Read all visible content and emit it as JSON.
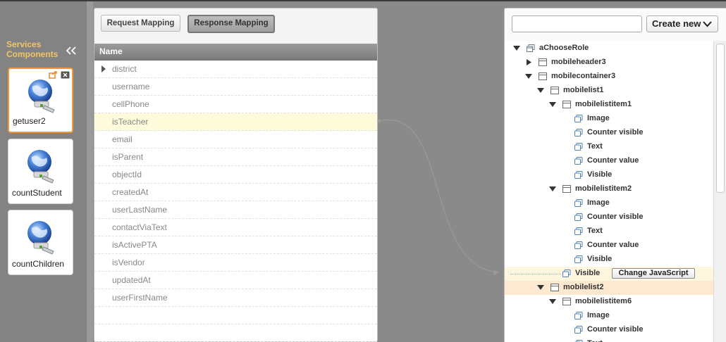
{
  "sidebar": {
    "title_line1": "Services",
    "title_line2": "Components",
    "services": [
      {
        "name": "getuser2",
        "selected": true
      },
      {
        "name": "countStudent",
        "selected": false
      },
      {
        "name": "countChildren",
        "selected": false
      }
    ]
  },
  "mapping": {
    "request_tab": "Request Mapping",
    "response_tab": "Response Mapping",
    "active_tab": "Response Mapping",
    "column_header": "Name",
    "fields": [
      "district",
      "username",
      "cellPhone",
      "isTeacher",
      "email",
      "isParent",
      "objectId",
      "createdAt",
      "userLastName",
      "contactViaText",
      "isActivePTA",
      "isVendor",
      "updatedAt",
      "userFirstName",
      "",
      ""
    ],
    "highlighted_field": "isTeacher"
  },
  "tree": {
    "search_placeholder": "",
    "create_new_label": "Create new",
    "change_js_label": "Change JavaScript",
    "nodes": [
      {
        "label": "aChooseRole",
        "level": 0,
        "toggle": "open",
        "icon": "page-icon"
      },
      {
        "label": "mobileheader3",
        "level": 1,
        "toggle": "closed",
        "icon": "container-icon"
      },
      {
        "label": "mobilecontainer3",
        "level": 1,
        "toggle": "open",
        "icon": "container-icon"
      },
      {
        "label": "mobilelist1",
        "level": 2,
        "toggle": "open",
        "icon": "container-icon"
      },
      {
        "label": "mobilelistitem1",
        "level": 3,
        "toggle": "open",
        "icon": "container-icon"
      },
      {
        "label": "Image",
        "level": 4,
        "toggle": "none",
        "icon": "property-icon"
      },
      {
        "label": "Counter visible",
        "level": 4,
        "toggle": "none",
        "icon": "property-icon"
      },
      {
        "label": "Text",
        "level": 4,
        "toggle": "none",
        "icon": "property-icon"
      },
      {
        "label": "Counter value",
        "level": 4,
        "toggle": "none",
        "icon": "property-icon"
      },
      {
        "label": "Visible",
        "level": 4,
        "toggle": "none",
        "icon": "property-icon"
      },
      {
        "label": "mobilelistitem2",
        "level": 3,
        "toggle": "open",
        "icon": "container-icon"
      },
      {
        "label": "Image",
        "level": 4,
        "toggle": "none",
        "icon": "property-icon"
      },
      {
        "label": "Counter visible",
        "level": 4,
        "toggle": "none",
        "icon": "property-icon"
      },
      {
        "label": "Text",
        "level": 4,
        "toggle": "none",
        "icon": "property-icon"
      },
      {
        "label": "Counter value",
        "level": 4,
        "toggle": "none",
        "icon": "property-icon"
      },
      {
        "label": "Visible",
        "level": 4,
        "toggle": "none",
        "icon": "property-icon"
      },
      {
        "label": "Visible",
        "level": 3,
        "toggle": "none",
        "icon": "property-icon",
        "mapped": true
      },
      {
        "label": "mobilelist2",
        "level": 2,
        "toggle": "open",
        "icon": "container-icon",
        "selected": true
      },
      {
        "label": "mobilelistitem6",
        "level": 3,
        "toggle": "open",
        "icon": "container-icon"
      },
      {
        "label": "Image",
        "level": 4,
        "toggle": "none",
        "icon": "property-icon"
      },
      {
        "label": "Counter visible",
        "level": 4,
        "toggle": "none",
        "icon": "property-icon"
      },
      {
        "label": "Text",
        "level": 4,
        "toggle": "none",
        "icon": "property-icon"
      }
    ]
  },
  "colors": {
    "accent_orange": "#ee9a3a",
    "sidebar_title": "#f3c562",
    "row_highlight": "#fdfbd9",
    "tree_selected": "#fde9cf",
    "tree_mapped": "#fef6df",
    "connector": "#999999"
  }
}
